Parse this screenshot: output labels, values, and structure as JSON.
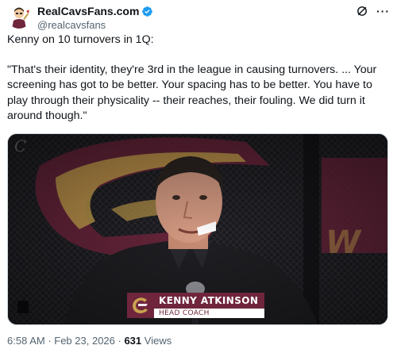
{
  "account": {
    "display_name": "RealCavsFans.com",
    "handle": "@realcavsfans",
    "verified": true,
    "avatar_icon": "cartoon-fan-avatar"
  },
  "actions": {
    "grok_icon": "grok-icon",
    "more_label": "···"
  },
  "post": {
    "intro": "Kenny on 10 turnovers in 1Q:",
    "quote": "\"That's their identity, they're 3rd in the league in causing turnovers. ... Your screening has got to be better. Your spacing has to be better. You have to play through their physicality -- their reaches, their fouling. We did turn it around though.\""
  },
  "media": {
    "lower_third_name": "KENNY ATKINSON",
    "lower_third_title": "HEAD COACH",
    "colors": {
      "wine": "#6f263d",
      "gold": "#c9a34e",
      "navy": "#041e42"
    }
  },
  "meta": {
    "time": "6:58 AM",
    "separator": " · ",
    "date": "Feb 23, 2026",
    "views_count": "631",
    "views_label": " Views"
  }
}
